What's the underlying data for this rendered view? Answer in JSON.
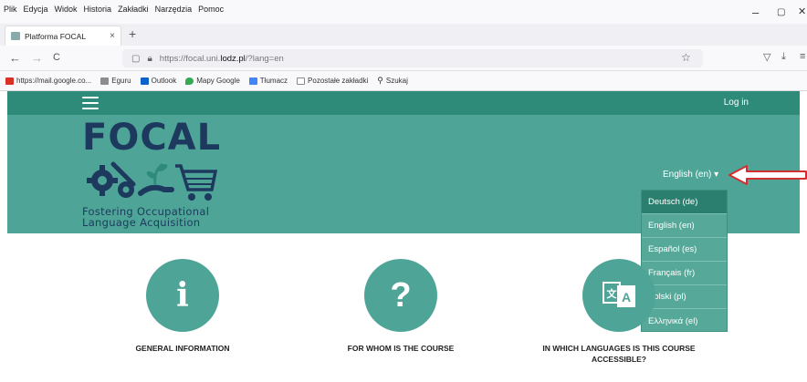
{
  "browser": {
    "menu": [
      "Plik",
      "Edycja",
      "Widok",
      "Historia",
      "Zakładki",
      "Narzędzia",
      "Pomoc"
    ],
    "window_controls": [
      "–",
      "▢",
      "✕"
    ],
    "tab": {
      "title": "Platforma FOCAL",
      "close": "×"
    },
    "new_tab": "+",
    "nav": {
      "back": "←",
      "forward": "→",
      "reload": "C"
    },
    "url": {
      "prefix": "https://focal.uni.",
      "domain": "lodz.pl",
      "suffix": "/?lang=en"
    },
    "bookmarks": [
      {
        "label": "https://mail.google.co...",
        "color": "#d93025"
      },
      {
        "label": "Eguru",
        "color": "#8c8c8c"
      },
      {
        "label": "Outlook",
        "color": "#0a64c8"
      },
      {
        "label": "Mapy Google",
        "color": "#34a853"
      },
      {
        "label": "Tłumacz",
        "color": "#4285f4"
      },
      {
        "label": "Pozostałe zakładki",
        "color": "#888888"
      },
      {
        "label": "Szukaj",
        "color": "#666666"
      }
    ]
  },
  "site": {
    "login": "Log in",
    "logo": {
      "title": "FOCAL",
      "line1": "Fostering Occupational",
      "line2": "Language Acquisition"
    },
    "language_selector": "English (en) ▾",
    "languages": [
      {
        "label": "Deutsch (de)",
        "active": true
      },
      {
        "label": "English (en)",
        "active": false
      },
      {
        "label": "Español (es)",
        "active": false
      },
      {
        "label": "Français (fr)",
        "active": false
      },
      {
        "label": "Polski (pl)",
        "active": false
      },
      {
        "label": "Ελληνικά (el)",
        "active": false
      }
    ],
    "cards": [
      {
        "icon": "info-icon",
        "glyph": "i",
        "title": "GENERAL INFORMATION"
      },
      {
        "icon": "question-icon",
        "glyph": "?",
        "title": "FOR WHOM IS THE COURSE"
      },
      {
        "icon": "translate-icon",
        "glyph": "",
        "title_line1": "IN WHICH LANGUAGES IS THIS COURSE",
        "title_line2": "ACCESSIBLE?"
      }
    ],
    "colors": {
      "primary": "#2e8b79",
      "hero": "#4ea597",
      "logo": "#1d3a5e",
      "arrow": "#d32f2f"
    }
  }
}
